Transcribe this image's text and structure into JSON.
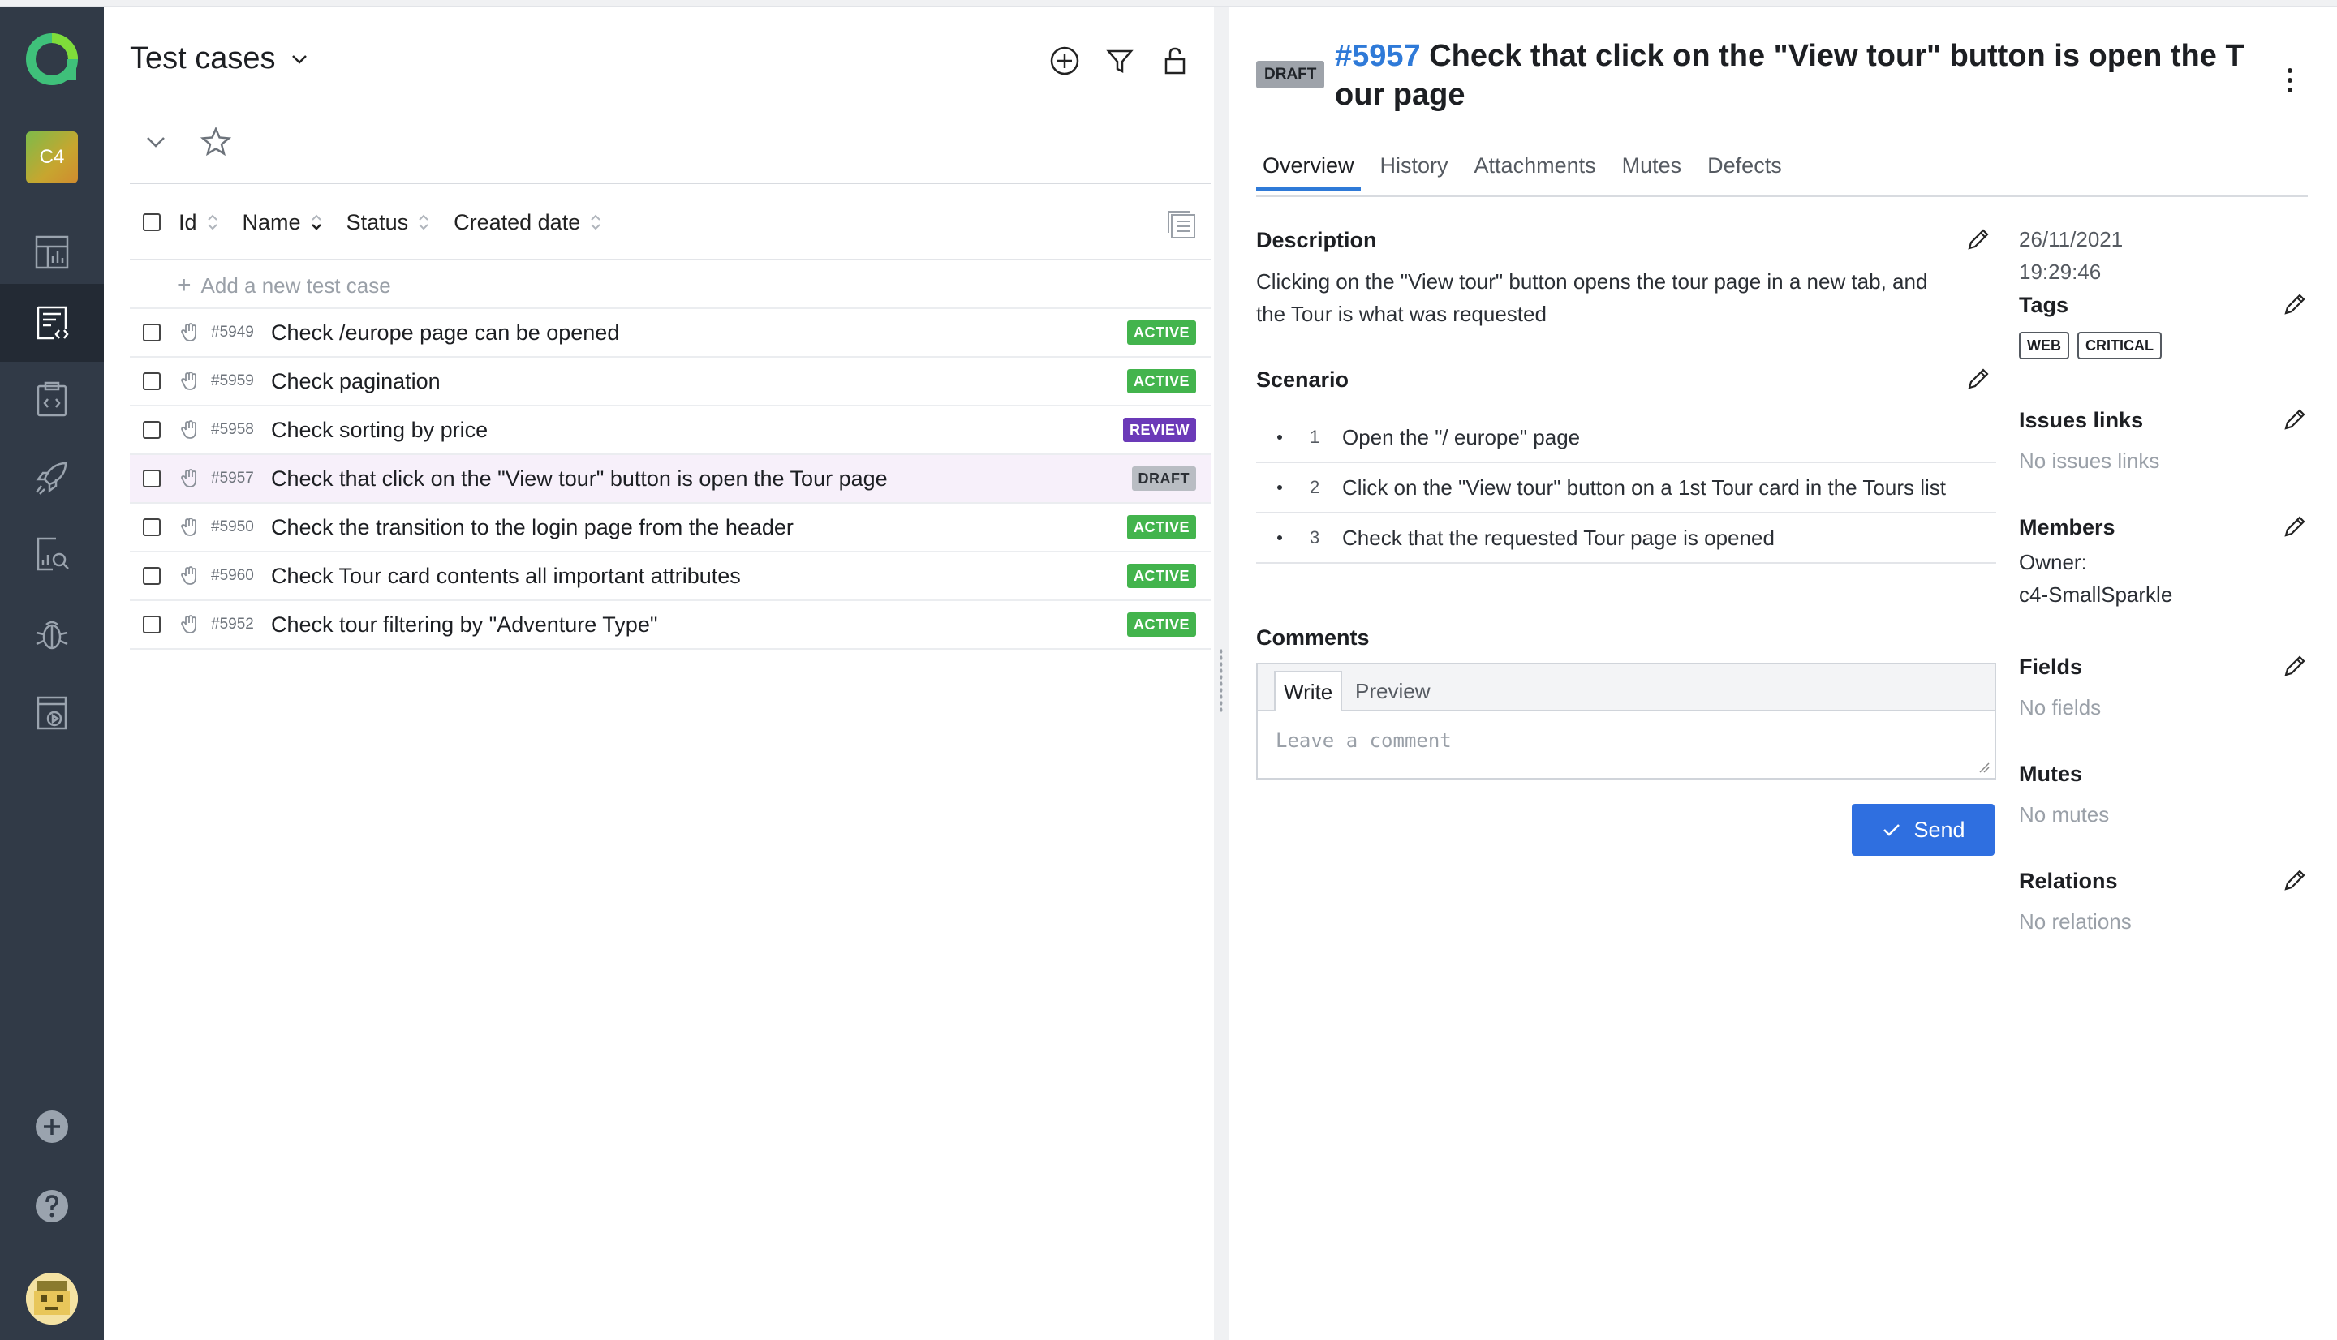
{
  "sidebar": {
    "project_badge": "C4",
    "items": [
      {
        "name": "dashboards-icon"
      },
      {
        "name": "test-cases-icon"
      },
      {
        "name": "test-plans-icon"
      },
      {
        "name": "launches-icon"
      },
      {
        "name": "analytics-icon"
      },
      {
        "name": "defects-icon"
      },
      {
        "name": "jobs-icon"
      }
    ],
    "bottom": [
      "add-icon",
      "help-icon",
      "avatar"
    ]
  },
  "list": {
    "title": "Test cases",
    "columns": {
      "id": "Id",
      "name": "Name",
      "status": "Status",
      "created": "Created date"
    },
    "add_placeholder": "Add a new test case",
    "rows": [
      {
        "id": "#5949",
        "name": "Check /europe page can be opened",
        "status": "ACTIVE"
      },
      {
        "id": "#5959",
        "name": "Check pagination",
        "status": "ACTIVE"
      },
      {
        "id": "#5958",
        "name": "Check sorting by price",
        "status": "REVIEW"
      },
      {
        "id": "#5957",
        "name": "Check that click on the \"View tour\" button is open the Tour page",
        "status": "DRAFT"
      },
      {
        "id": "#5950",
        "name": "Check the transition to the login page from the header",
        "status": "ACTIVE"
      },
      {
        "id": "#5960",
        "name": "Check Tour card contents all important attributes",
        "status": "ACTIVE"
      },
      {
        "id": "#5952",
        "name": "Check tour filtering by \"Adventure Type\"",
        "status": "ACTIVE"
      }
    ]
  },
  "detail": {
    "status": "DRAFT",
    "number": "#5957",
    "title_line1": "Check that click on the \"View tour\" button is open the T",
    "title_line2": "our page",
    "tabs": [
      "Overview",
      "History",
      "Attachments",
      "Mutes",
      "Defects"
    ],
    "description_label": "Description",
    "description_line1": "Clicking on the \"View tour\" button opens the tour page in a new tab, and",
    "description_line2": "the Tour is what was requested",
    "scenario_label": "Scenario",
    "steps": [
      {
        "n": "1",
        "text": "Open the \"/ europe\" page"
      },
      {
        "n": "2",
        "text": "Click on the \"View tour\" button on a 1st Tour card in the Tours list"
      },
      {
        "n": "3",
        "text": "Check that the requested Tour page is opened"
      }
    ],
    "comments_label": "Comments",
    "comment_tabs": {
      "write": "Write",
      "preview": "Preview"
    },
    "comment_placeholder": "Leave a comment",
    "send_label": "Send",
    "meta": {
      "date": "26/11/2021",
      "time": "19:29:46",
      "tags_label": "Tags",
      "tags": [
        "WEB",
        "CRITICAL"
      ],
      "issues_label": "Issues links",
      "issues_empty": "No issues links",
      "members_label": "Members",
      "owner_label": "Owner:",
      "owner": "c4-SmallSparkle",
      "fields_label": "Fields",
      "fields_empty": "No fields",
      "mutes_label": "Mutes",
      "mutes_empty": "No mutes",
      "relations_label": "Relations",
      "relations_empty": "No relations"
    }
  },
  "colors": {
    "accent": "#2f7ad8",
    "send": "#2f6fe0",
    "active": "#43b44d",
    "review": "#6b3ab8",
    "draft": "#b9bdc3",
    "sidebar": "#313a47"
  }
}
